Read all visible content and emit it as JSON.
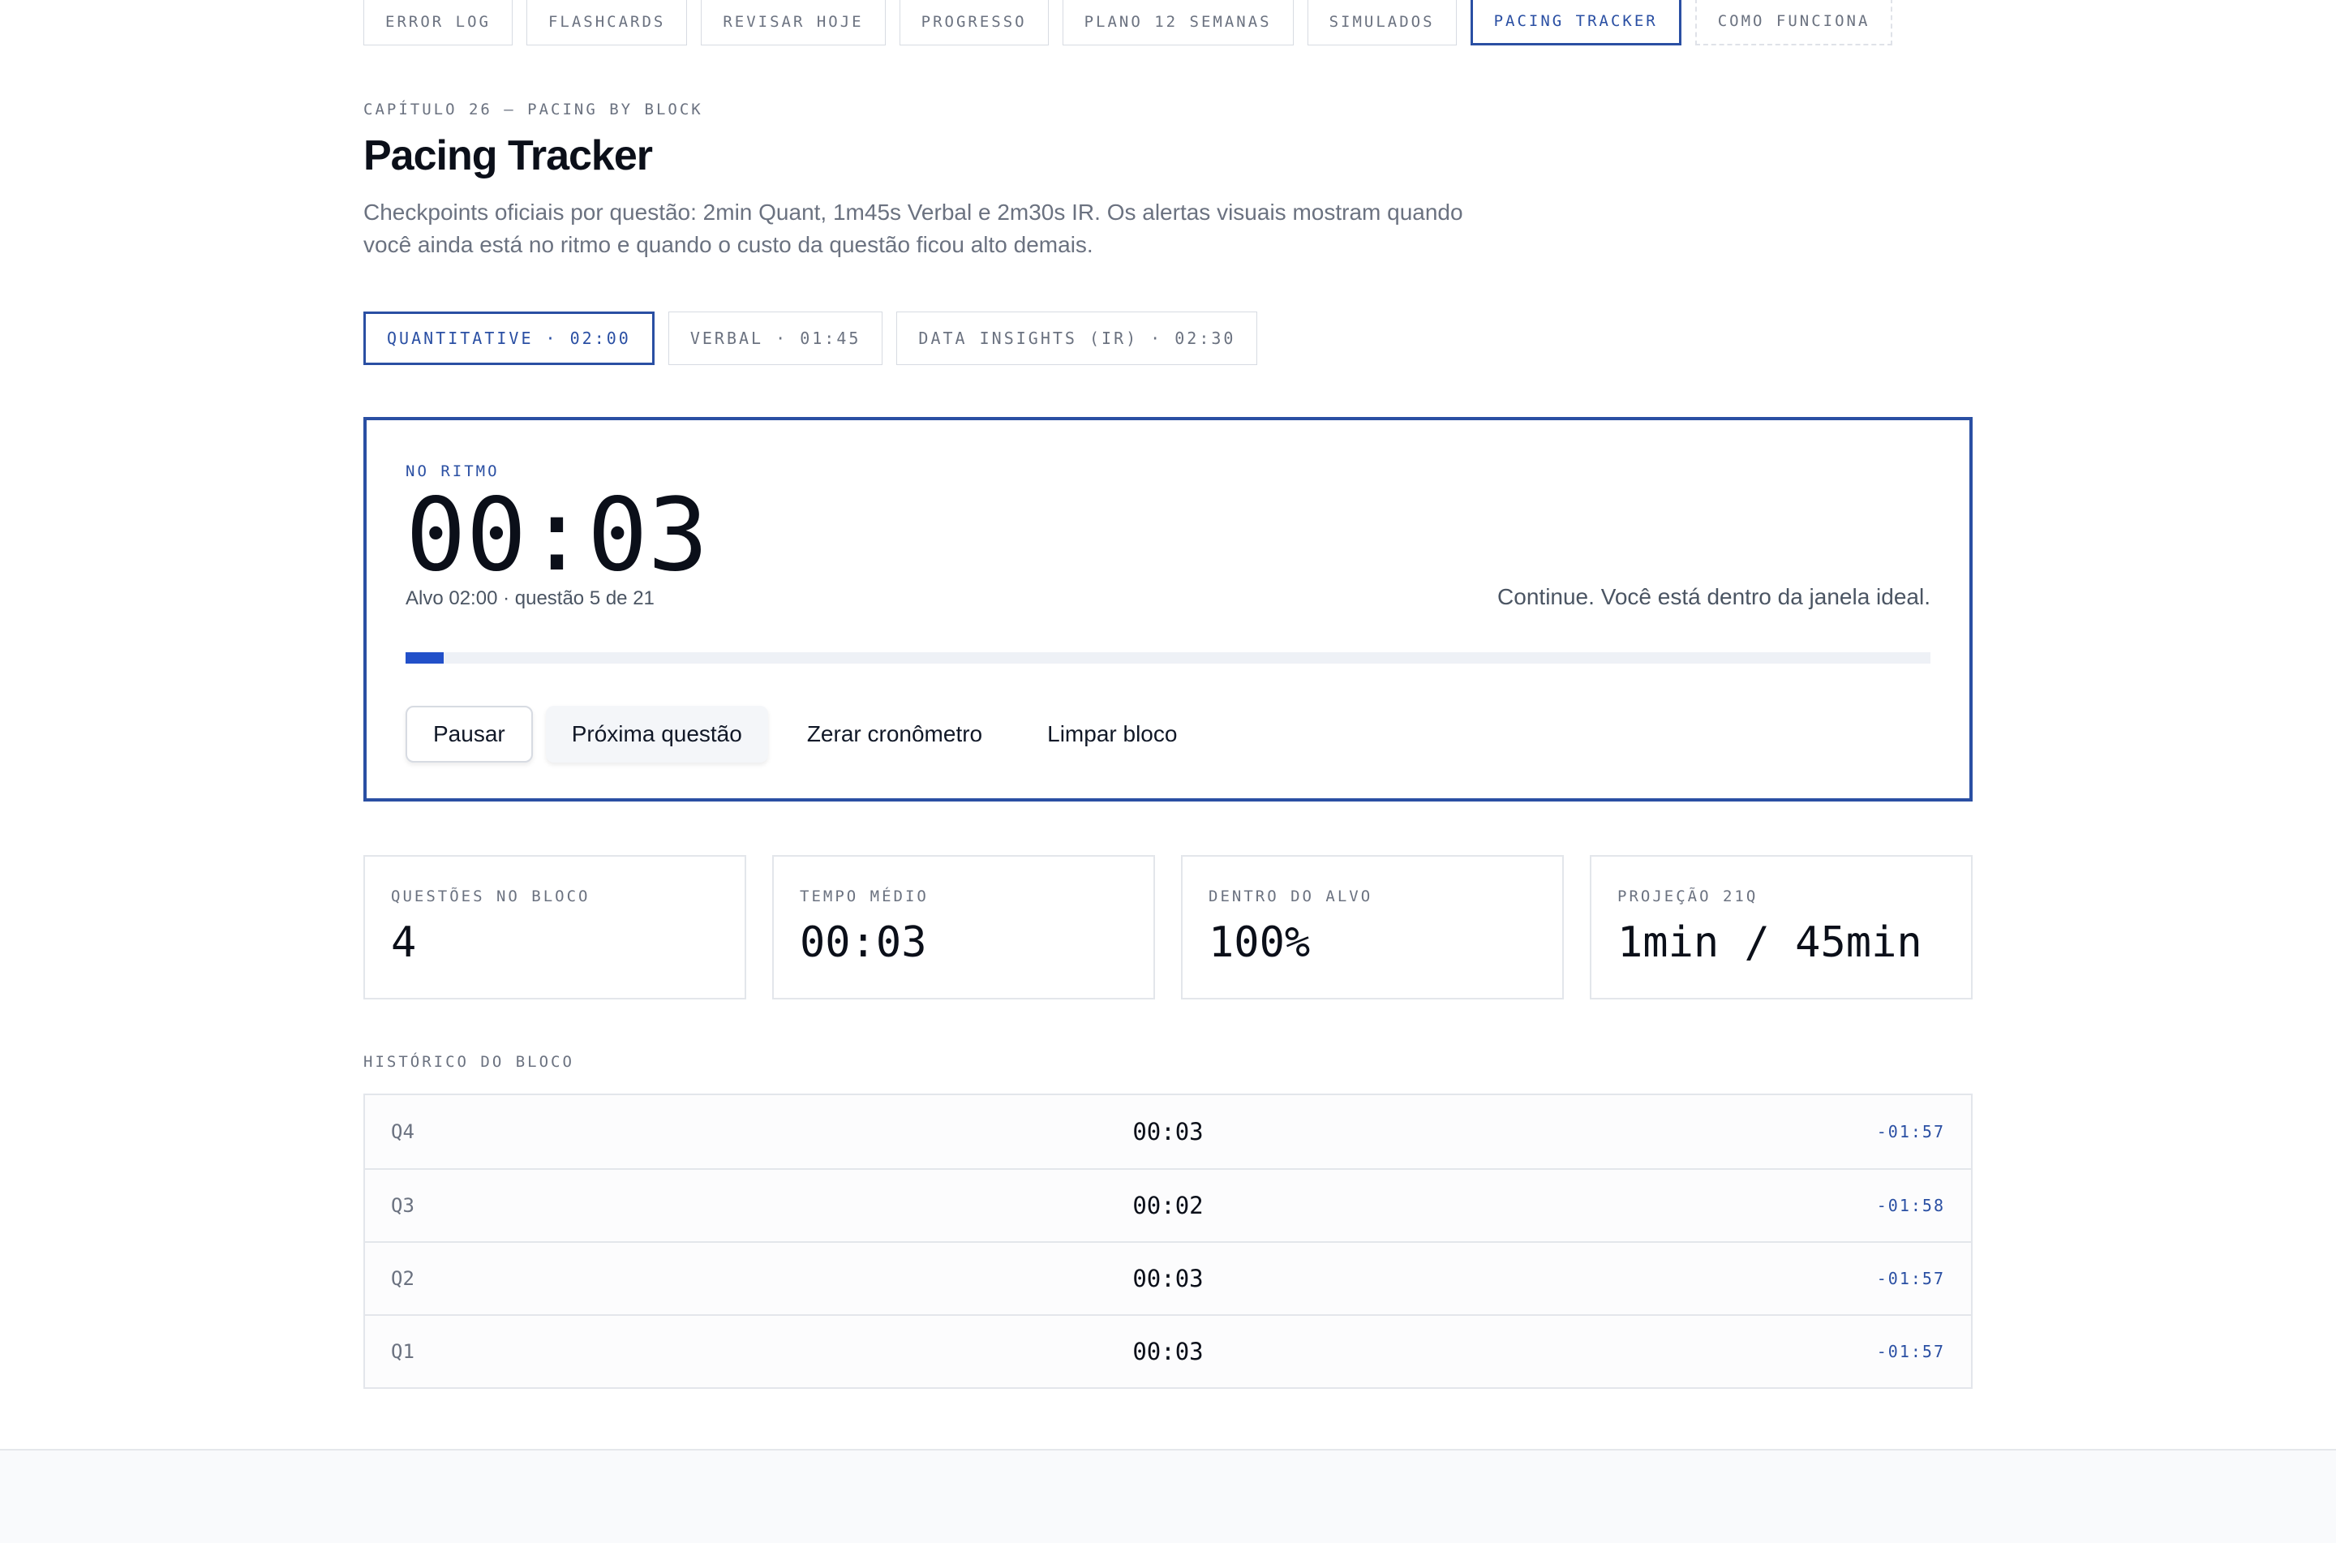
{
  "nav": {
    "tabs": [
      {
        "label": "ERROR LOG"
      },
      {
        "label": "FLASHCARDS"
      },
      {
        "label": "REVISAR HOJE"
      },
      {
        "label": "PROGRESSO"
      },
      {
        "label": "PLANO 12 SEMANAS"
      },
      {
        "label": "SIMULADOS"
      },
      {
        "label": "PACING TRACKER"
      },
      {
        "label": "COMO FUNCIONA"
      }
    ],
    "active": "PACING TRACKER"
  },
  "header": {
    "eyebrow": "CAPÍTULO 26 — PACING BY BLOCK",
    "title": "Pacing Tracker",
    "description": "Checkpoints oficiais por questão: 2min Quant, 1m45s Verbal e 2m30s IR. Os alertas visuais mostram quando você ainda está no ritmo e quando o custo da questão ficou alto demais."
  },
  "sections": {
    "tabs": [
      {
        "label": "QUANTITATIVE · 02:00"
      },
      {
        "label": "VERBAL · 01:45"
      },
      {
        "label": "DATA INSIGHTS (IR) · 02:30"
      }
    ],
    "active": "QUANTITATIVE · 02:00"
  },
  "timer": {
    "status": "NO RITMO",
    "clock": "00:03",
    "target_text": "Alvo 02:00 · questão 5 de 21",
    "message": "Continue. Você está dentro da janela ideal.",
    "progress_fraction": 0.025,
    "progress_color": "#2250c9",
    "buttons": {
      "pause": "Pausar",
      "next": "Próxima questão",
      "reset": "Zerar cronômetro",
      "clear": "Limpar bloco"
    }
  },
  "stats": [
    {
      "label": "QUESTÕES NO BLOCO",
      "value": "4"
    },
    {
      "label": "TEMPO MÉDIO",
      "value": "00:03"
    },
    {
      "label": "DENTRO DO ALVO",
      "value": "100%"
    },
    {
      "label": "PROJEÇÃO 21Q",
      "value": "1min / 45min"
    }
  ],
  "history": {
    "label": "HISTÓRICO DO BLOCO",
    "rows": [
      {
        "q": "Q4",
        "time": "00:03",
        "delta": "-01:57"
      },
      {
        "q": "Q3",
        "time": "00:02",
        "delta": "-01:58"
      },
      {
        "q": "Q2",
        "time": "00:03",
        "delta": "-01:57"
      },
      {
        "q": "Q1",
        "time": "00:03",
        "delta": "-01:57"
      }
    ]
  },
  "colors": {
    "accent": "#2a4fa3",
    "progress": "#2250c9"
  }
}
